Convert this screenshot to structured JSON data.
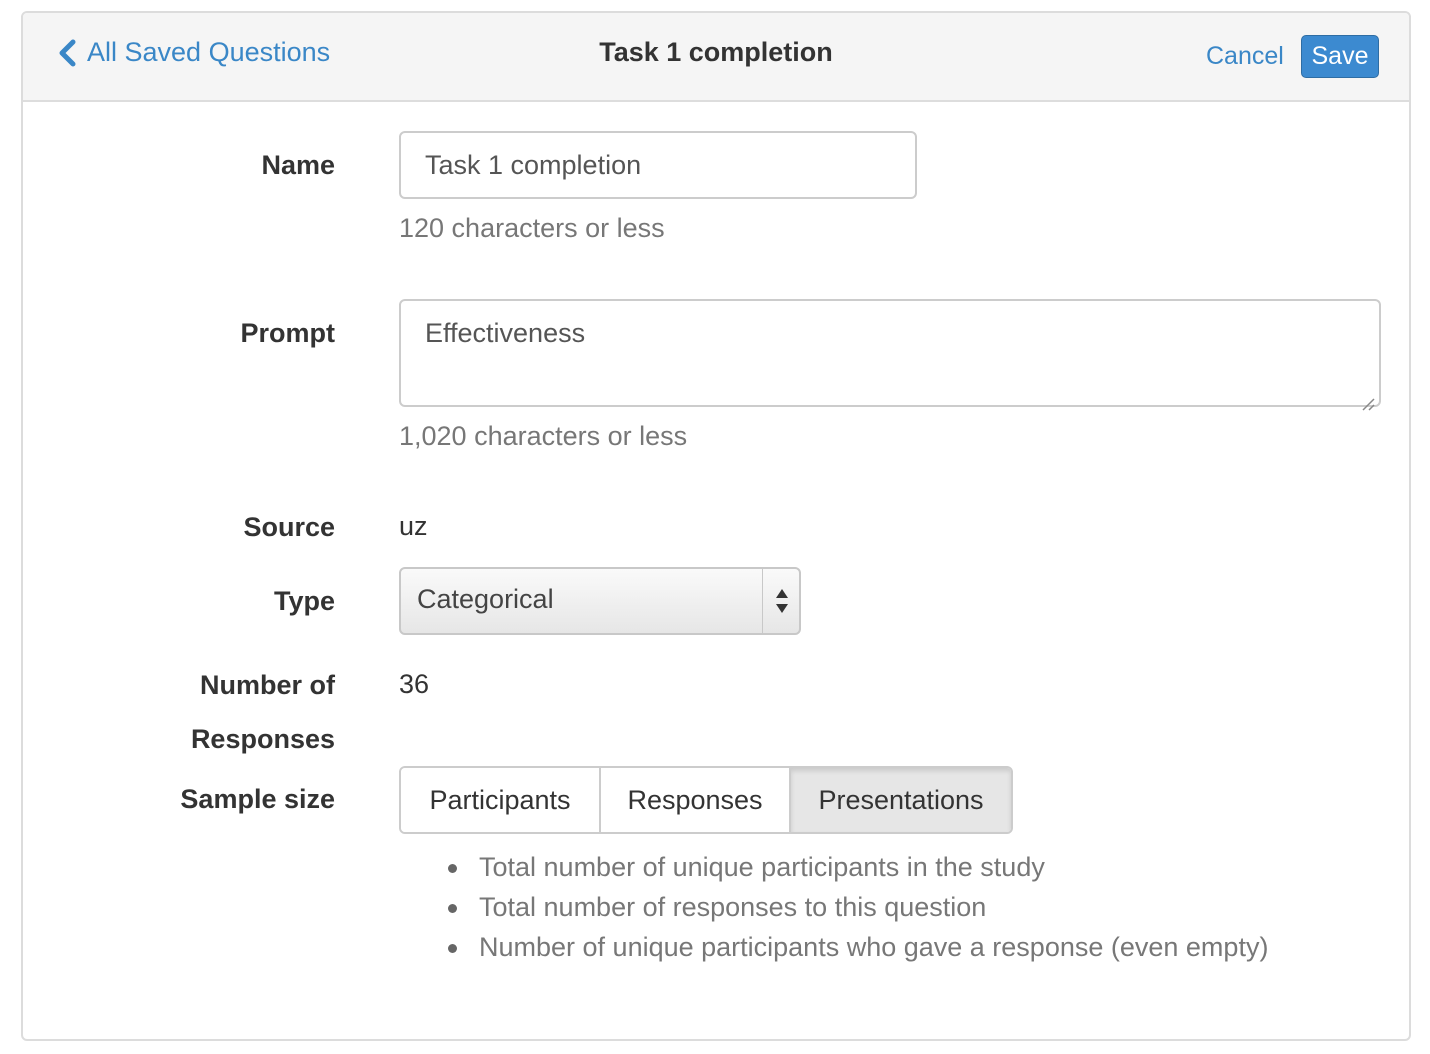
{
  "header": {
    "back_label": "All Saved Questions",
    "title": "Task 1 completion",
    "cancel_label": "Cancel",
    "save_label": "Save"
  },
  "form": {
    "name": {
      "label": "Name",
      "value": "Task 1 completion",
      "help": "120 characters or less"
    },
    "prompt": {
      "label": "Prompt",
      "value": "Effectiveness",
      "help": "1,020 characters or less"
    },
    "source": {
      "label": "Source",
      "value": "uz"
    },
    "type": {
      "label": "Type",
      "selected": "Categorical"
    },
    "responses": {
      "label_line1": "Number of",
      "label_line2": "Responses",
      "value": "36"
    },
    "sample_size": {
      "label": "Sample size",
      "options": [
        "Participants",
        "Responses",
        "Presentations"
      ],
      "active": "Presentations",
      "descriptions": [
        "Total number of unique participants in the study",
        "Total number of responses to this question",
        "Number of unique participants who gave a response (even empty)"
      ]
    }
  },
  "colors": {
    "link": "#3a87c7",
    "primary_button": "#3c8ad0",
    "header_bg": "#f5f5f5",
    "help_text": "#777777"
  },
  "icons": {
    "back": "chevron-left-icon",
    "select_arrows": "sort-arrows-icon",
    "resize": "resize-grip-icon"
  }
}
